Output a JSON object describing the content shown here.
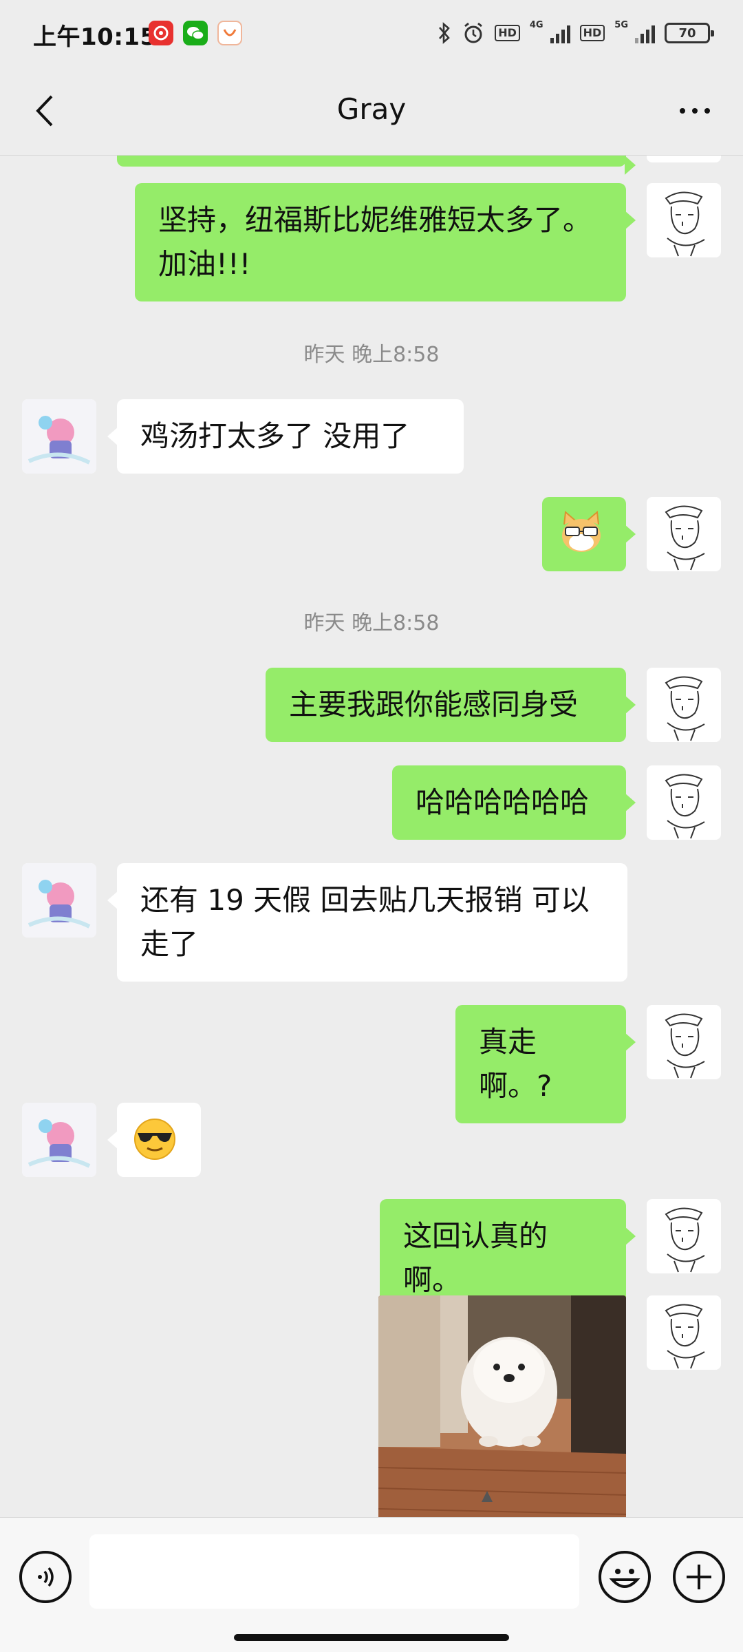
{
  "status_bar": {
    "time": "上午10:15",
    "signal_1": "4G",
    "signal_2": "5G",
    "hd_badge": "HD",
    "battery": "70"
  },
  "header": {
    "title": "Gray"
  },
  "messages": [
    {
      "side": "me",
      "text": "坚持，纽福斯比妮维雅短太多了。加油!!!"
    },
    {
      "type": "time",
      "text": "昨天 晚上8:58"
    },
    {
      "side": "other",
      "text": "鸡汤打太多了 没用了"
    },
    {
      "side": "me",
      "type": "sticker",
      "icon": "cat-glasses-emoji"
    },
    {
      "type": "time",
      "text": "昨天 晚上8:58"
    },
    {
      "side": "me",
      "text": "主要我跟你能感同身受"
    },
    {
      "side": "me",
      "text": "哈哈哈哈哈哈"
    },
    {
      "side": "other",
      "text": "还有 19 天假 回去贴几天报销 可以走了"
    },
    {
      "side": "me",
      "text": "真走啊。?"
    },
    {
      "side": "other",
      "type": "emoji",
      "icon": "sunglasses-emoji"
    },
    {
      "side": "me",
      "text": "这回认真的啊。"
    },
    {
      "side": "me",
      "type": "image",
      "icon": "puppy-photo"
    }
  ],
  "input": {
    "value": "",
    "placeholder": ""
  },
  "colors": {
    "background": "#ededed",
    "my_bubble": "#95ec69",
    "other_bubble": "#ffffff"
  }
}
